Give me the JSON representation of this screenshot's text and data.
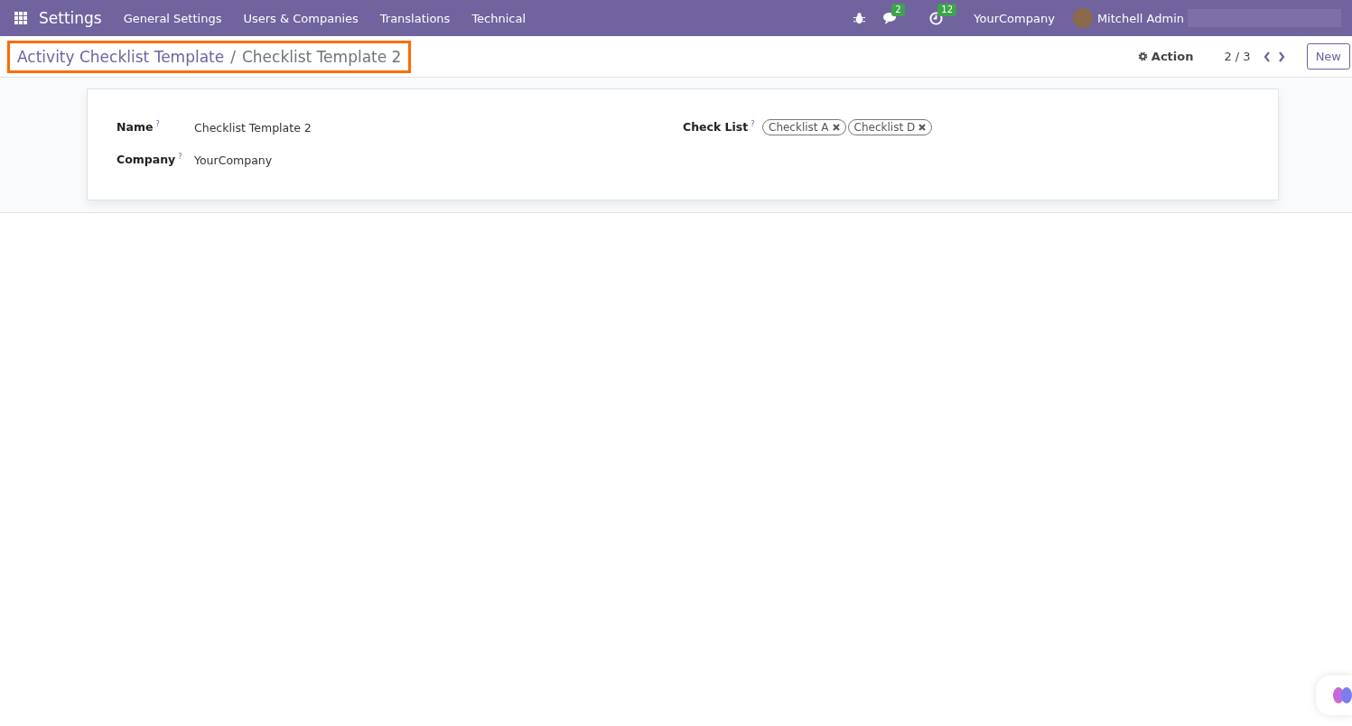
{
  "navbar": {
    "app": "Settings",
    "menus": [
      "General Settings",
      "Users & Companies",
      "Translations",
      "Technical"
    ],
    "messages_badge": "2",
    "activities_badge": "12",
    "company": "YourCompany",
    "user": "Mitchell Admin"
  },
  "breadcrumb": {
    "parent": "Activity Checklist Template",
    "separator": "/",
    "current": "Checklist Template 2",
    "highlighted": true
  },
  "control_panel": {
    "action": "Action",
    "pager": "2 / 3",
    "new_button": "New"
  },
  "form": {
    "left": [
      {
        "label": "Name",
        "help": "?",
        "value": "Checklist Template 2"
      },
      {
        "label": "Company",
        "help": "?",
        "value": "YourCompany"
      }
    ],
    "check_list": {
      "label": "Check List",
      "help": "?",
      "tags": [
        "Checklist A",
        "Checklist D"
      ]
    }
  }
}
